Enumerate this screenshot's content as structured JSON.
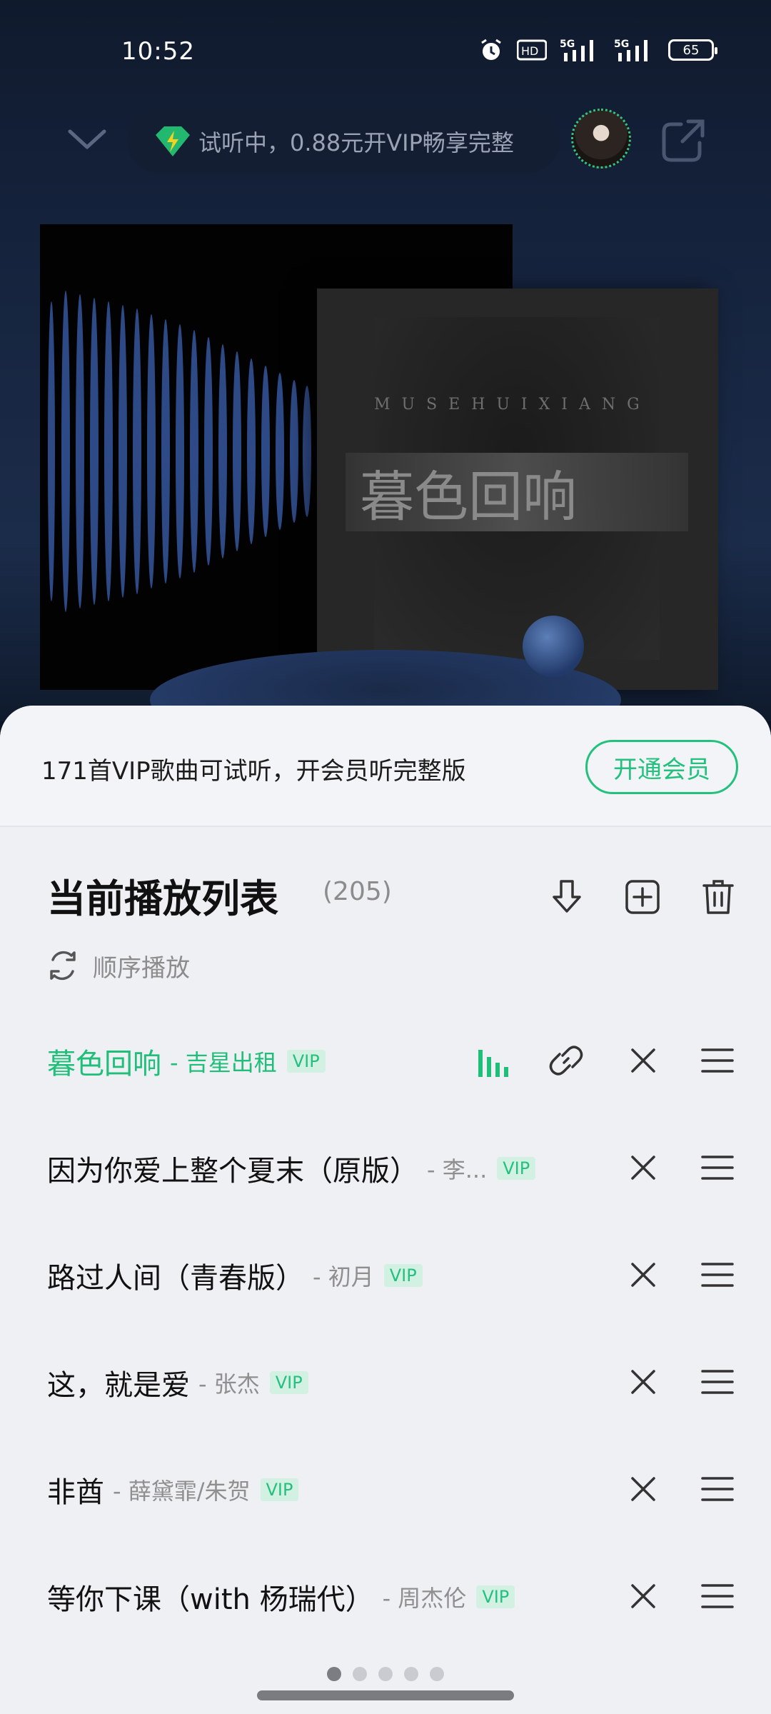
{
  "status_bar": {
    "time": "10:52",
    "battery": "65",
    "icons": [
      "alarm-icon",
      "hd-icon",
      "signal-5g-icon",
      "signal-5g-icon",
      "battery-icon"
    ]
  },
  "header": {
    "trial_text": "试听中，0.88元开VIP畅享完整",
    "icons": [
      "chevron-down-icon",
      "vip-gem-icon",
      "share-icon"
    ]
  },
  "album_art": {
    "title_text": "暮色回响",
    "letters": "MUSEHUIXIANG"
  },
  "promo": {
    "text": "171首VIP歌曲可试听，开会员听完整版",
    "button": "开通会员"
  },
  "playlist": {
    "title": "当前播放列表",
    "count": "(205)",
    "play_mode": "顺序播放",
    "songs": [
      {
        "title": "暮色回响",
        "artist": "- 吉星出租",
        "badge": "VIP",
        "active": true
      },
      {
        "title": "因为你爱上整个夏末（原版）",
        "artist": "- 李...",
        "badge": "VIP",
        "active": false
      },
      {
        "title": "路过人间（青春版）",
        "artist": "- 初月",
        "badge": "VIP",
        "active": false
      },
      {
        "title": "这，就是爱",
        "artist": "- 张杰",
        "badge": "VIP",
        "active": false
      },
      {
        "title": "非酋",
        "artist": "- 薛黛霏/朱贺",
        "badge": "VIP",
        "active": false
      },
      {
        "title": "等你下课（with 杨瑞代）",
        "artist": "- 周杰伦",
        "badge": "VIP",
        "active": false
      }
    ]
  },
  "colors": {
    "accent": "#20bf79",
    "sheet_bg": "#eef0f4",
    "top_bg": "#15233d"
  },
  "pager": {
    "total": 5,
    "current": 1
  }
}
